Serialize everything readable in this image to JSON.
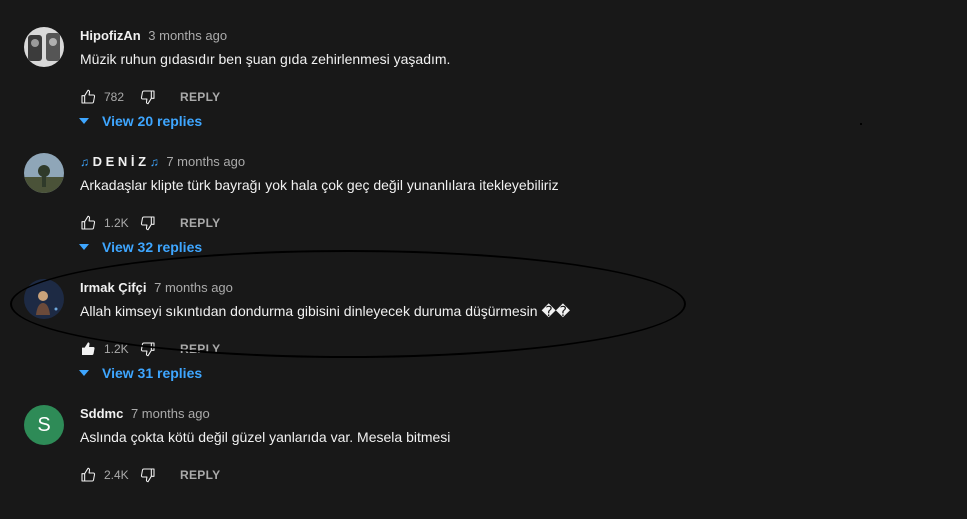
{
  "comments": [
    {
      "author": "HipofizAn",
      "author_note": "",
      "time": "3 months ago",
      "text": "Müzik ruhun gıdasıdır ben şuan gıda zehirlenmesi yaşadım.",
      "likes": "782",
      "reply_label": "REPLY",
      "replies_label": "View 20 replies",
      "avatar_letter": "",
      "liked": false
    },
    {
      "author": "D E N İ Z",
      "author_note": "♫",
      "time": "7 months ago",
      "text": "Arkadaşlar klipte türk bayrağı yok hala çok geç değil yunanlılara itekleyebiliriz",
      "likes": "1.2K",
      "reply_label": "REPLY",
      "replies_label": "View 32 replies",
      "avatar_letter": "",
      "liked": false
    },
    {
      "author": "Irmak Çifçi",
      "author_note": "",
      "time": "7 months ago",
      "text": "Allah kimseyi sıkıntıdan dondurma gibisini dinleyecek duruma düşürmesin ��",
      "likes": "1.2K",
      "reply_label": "REPLY",
      "replies_label": "View 31 replies",
      "avatar_letter": "",
      "liked": true
    },
    {
      "author": "Sddmc",
      "author_note": "",
      "time": "7 months ago",
      "text": "Aslında çokta kötü değil güzel yanlarıda var. Mesela bitmesi",
      "likes": "2.4K",
      "reply_label": "REPLY",
      "replies_label": "",
      "avatar_letter": "S",
      "liked": false
    }
  ],
  "colors": {
    "background": "#181818",
    "link": "#3ea6ff",
    "secondary_text": "#aaaaaa",
    "avatar_s": "#2e8b57"
  },
  "icons": [
    "thumb-up-icon",
    "thumb-down-icon",
    "caret-down-icon"
  ]
}
